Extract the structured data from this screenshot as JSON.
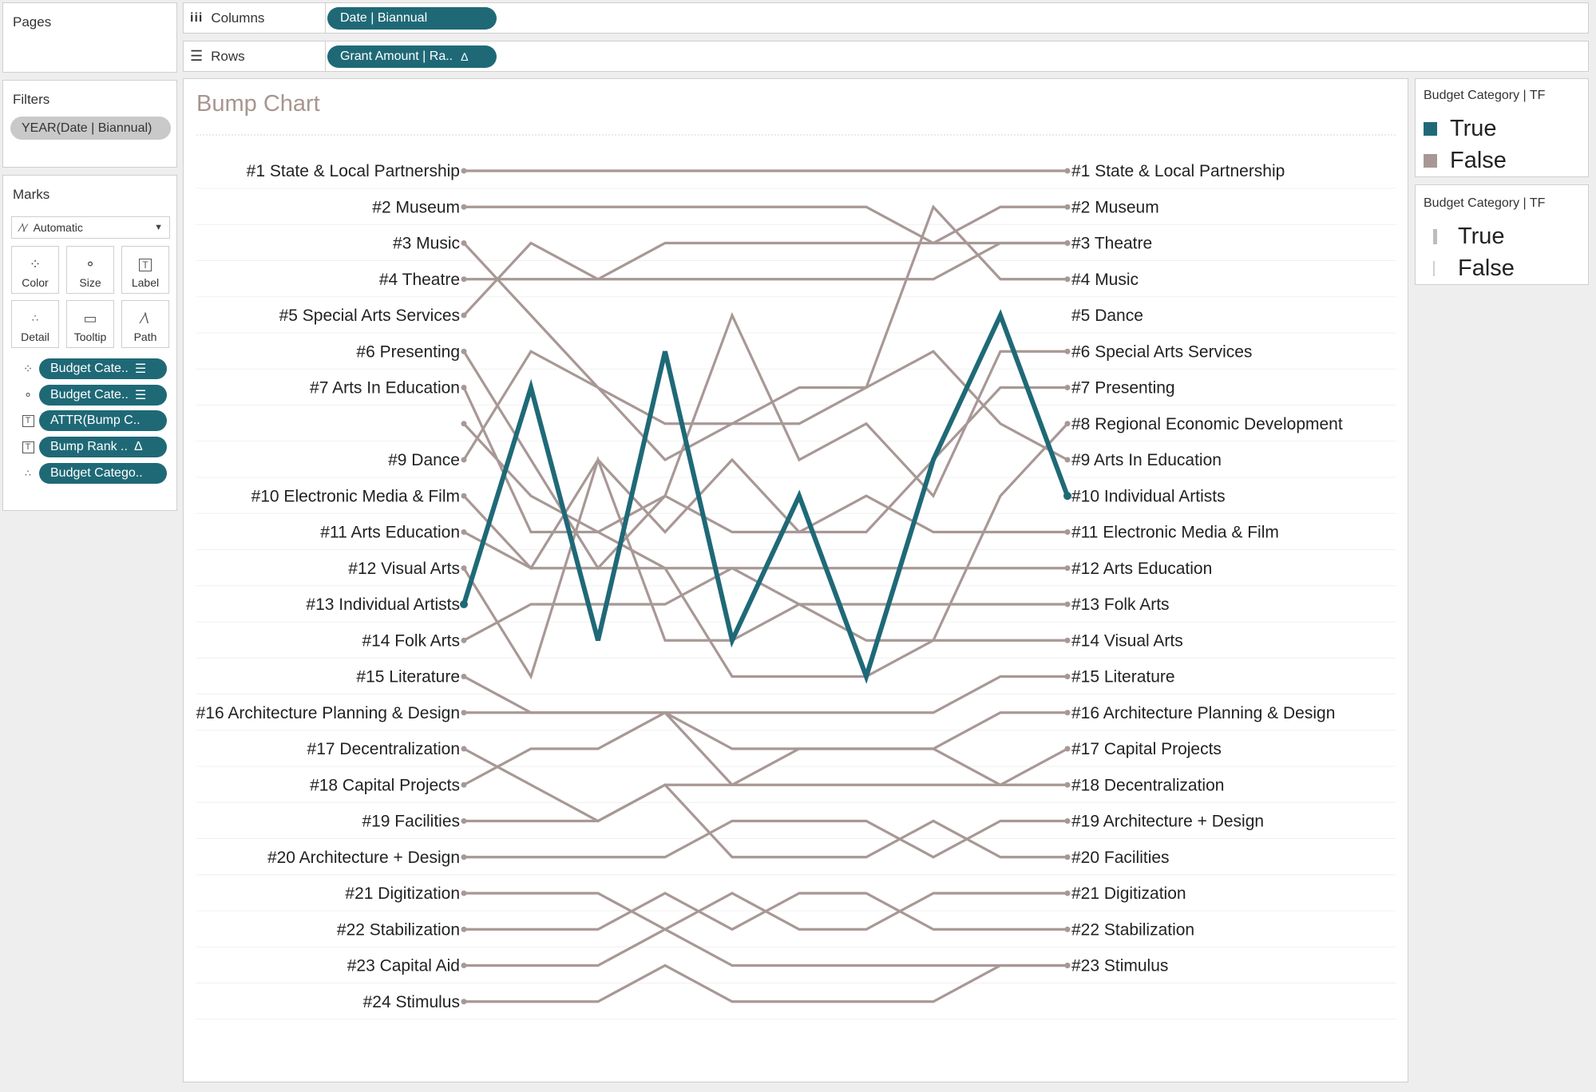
{
  "pages_shelf": {
    "title": "Pages"
  },
  "columns_shelf": {
    "label": "Columns",
    "pill": "Date | Biannual"
  },
  "rows_shelf": {
    "label": "Rows",
    "pill": "Grant Amount | Ra..",
    "pill_delta": "Δ"
  },
  "filters": {
    "title": "Filters",
    "items": [
      "YEAR(Date | Biannual)"
    ]
  },
  "marks": {
    "title": "Marks",
    "type": "Automatic",
    "buttons": {
      "color": "Color",
      "size": "Size",
      "label": "Label",
      "detail": "Detail",
      "tooltip": "Tooltip",
      "path": "Path"
    },
    "fields": [
      {
        "icon": "color-dots-icon",
        "label": "Budget Cate..",
        "suffix": "sort-icon"
      },
      {
        "icon": "size-icon",
        "label": "Budget Cate..",
        "suffix": "sort-icon"
      },
      {
        "icon": "label-text-icon",
        "label": "ATTR(Bump C.."
      },
      {
        "icon": "label-text-icon",
        "label": "Bump Rank ..",
        "suffix": "Δ"
      },
      {
        "icon": "detail-icon",
        "label": "Budget Catego.."
      }
    ]
  },
  "legend_color": {
    "title": "Budget Category | TF",
    "items": [
      {
        "label": "True",
        "color": "#1f6977"
      },
      {
        "label": "False",
        "color": "#a89895"
      }
    ]
  },
  "legend_size": {
    "title": "Budget Category | TF",
    "items": [
      {
        "label": "True"
      },
      {
        "label": "False"
      }
    ]
  },
  "chart_data": {
    "type": "line",
    "title": "Bump Chart",
    "x": [
      0,
      1,
      2,
      3,
      4,
      5,
      6,
      7,
      8,
      9
    ],
    "y_reversed": true,
    "ylim": [
      1,
      24
    ],
    "colors": {
      "highlight": "#1f6977",
      "default": "#a89895"
    },
    "left_labels": [
      {
        "rank": 1,
        "text": "#1 State & Local Partnership"
      },
      {
        "rank": 2,
        "text": "#2 Museum"
      },
      {
        "rank": 3,
        "text": "#3 Music"
      },
      {
        "rank": 4,
        "text": "#4 Theatre"
      },
      {
        "rank": 5,
        "text": "#5 Special Arts Services"
      },
      {
        "rank": 6,
        "text": "#6 Presenting"
      },
      {
        "rank": 7,
        "text": "#7 Arts In Education"
      },
      {
        "rank": 9,
        "text": "#9 Dance"
      },
      {
        "rank": 10,
        "text": "#10 Electronic Media & Film"
      },
      {
        "rank": 11,
        "text": "#11 Arts Education"
      },
      {
        "rank": 12,
        "text": "#12 Visual Arts"
      },
      {
        "rank": 13,
        "text": "#13 Individual Artists"
      },
      {
        "rank": 14,
        "text": "#14 Folk Arts"
      },
      {
        "rank": 15,
        "text": "#15 Literature"
      },
      {
        "rank": 16,
        "text": "#16 Architecture Planning & Design"
      },
      {
        "rank": 17,
        "text": "#17 Decentralization"
      },
      {
        "rank": 18,
        "text": "#18 Capital Projects"
      },
      {
        "rank": 19,
        "text": "#19 Facilities"
      },
      {
        "rank": 20,
        "text": "#20 Architecture + Design"
      },
      {
        "rank": 21,
        "text": "#21 Digitization"
      },
      {
        "rank": 22,
        "text": "#22 Stabilization"
      },
      {
        "rank": 23,
        "text": "#23 Capital Aid"
      },
      {
        "rank": 24,
        "text": "#24 Stimulus"
      }
    ],
    "right_labels": [
      {
        "rank": 1,
        "text": "#1 State & Local Partnership"
      },
      {
        "rank": 2,
        "text": "#2 Museum"
      },
      {
        "rank": 3,
        "text": "#3 Theatre"
      },
      {
        "rank": 4,
        "text": "#4 Music"
      },
      {
        "rank": 5,
        "text": "#5 Dance"
      },
      {
        "rank": 6,
        "text": "#6 Special Arts Services"
      },
      {
        "rank": 7,
        "text": "#7 Presenting"
      },
      {
        "rank": 8,
        "text": "#8 Regional Economic Development"
      },
      {
        "rank": 9,
        "text": "#9 Arts In Education"
      },
      {
        "rank": 10,
        "text": "#10 Individual Artists"
      },
      {
        "rank": 11,
        "text": "#11 Electronic Media & Film"
      },
      {
        "rank": 12,
        "text": "#12 Arts Education"
      },
      {
        "rank": 13,
        "text": "#13 Folk Arts"
      },
      {
        "rank": 14,
        "text": "#14 Visual Arts"
      },
      {
        "rank": 15,
        "text": "#15 Literature"
      },
      {
        "rank": 16,
        "text": "#16 Architecture Planning & Design"
      },
      {
        "rank": 17,
        "text": "#17 Capital Projects"
      },
      {
        "rank": 18,
        "text": "#18 Decentralization"
      },
      {
        "rank": 19,
        "text": "#19 Architecture + Design"
      },
      {
        "rank": 20,
        "text": "#20 Facilities"
      },
      {
        "rank": 21,
        "text": "#21 Digitization"
      },
      {
        "rank": 22,
        "text": "#22 Stabilization"
      },
      {
        "rank": 23,
        "text": "#23 Stimulus"
      }
    ],
    "series": [
      {
        "name": "Individual Artists",
        "highlight": true,
        "values": [
          13,
          7,
          14,
          6,
          14,
          10,
          15,
          9,
          5,
          10
        ]
      },
      {
        "values": [
          1,
          1,
          1,
          1,
          1,
          1,
          1,
          1,
          1,
          1
        ]
      },
      {
        "values": [
          2,
          2,
          2,
          2,
          2,
          2,
          2,
          3,
          2,
          2
        ]
      },
      {
        "values": [
          3,
          5,
          7,
          9,
          8,
          7,
          7,
          2,
          4,
          4
        ]
      },
      {
        "values": [
          4,
          4,
          4,
          4,
          4,
          4,
          4,
          4,
          3,
          3
        ]
      },
      {
        "values": [
          5,
          3,
          4,
          3,
          3,
          3,
          3,
          3,
          3,
          3
        ]
      },
      {
        "values": [
          6,
          9,
          12,
          10,
          11,
          11,
          11,
          9,
          7,
          7
        ]
      },
      {
        "values": [
          7,
          11,
          11,
          10,
          5,
          9,
          8,
          10,
          6,
          6
        ]
      },
      {
        "values": [
          9,
          6,
          7,
          8,
          8,
          8,
          7,
          6,
          8,
          9
        ]
      },
      {
        "values": [
          10,
          12,
          9,
          11,
          9,
          11,
          10,
          11,
          11,
          11
        ]
      },
      {
        "values": [
          11,
          12,
          12,
          12,
          12,
          12,
          12,
          12,
          12,
          12
        ]
      },
      {
        "values": [
          12,
          15,
          9,
          14,
          14,
          13,
          14,
          14,
          14,
          14
        ]
      },
      {
        "values": [
          14,
          13,
          13,
          13,
          12,
          13,
          13,
          13,
          13,
          13
        ]
      },
      {
        "values": [
          15,
          16,
          16,
          16,
          16,
          16,
          16,
          16,
          15,
          15
        ]
      },
      {
        "values": [
          16,
          16,
          16,
          16,
          17,
          17,
          17,
          17,
          16,
          16
        ]
      },
      {
        "values": [
          17,
          18,
          19,
          18,
          18,
          18,
          18,
          18,
          18,
          18
        ]
      },
      {
        "values": [
          18,
          17,
          17,
          16,
          18,
          17,
          17,
          17,
          18,
          17
        ]
      },
      {
        "values": [
          19,
          19,
          19,
          18,
          20,
          20,
          20,
          19,
          20,
          20
        ]
      },
      {
        "values": [
          20,
          20,
          20,
          20,
          19,
          19,
          19,
          20,
          19,
          19
        ]
      },
      {
        "values": [
          21,
          21,
          21,
          22,
          21,
          22,
          22,
          21,
          21,
          21
        ]
      },
      {
        "values": [
          22,
          22,
          22,
          21,
          22,
          21,
          21,
          22,
          22,
          22
        ]
      },
      {
        "values": [
          23,
          23,
          23,
          22,
          23,
          23,
          23,
          23,
          23,
          23
        ]
      },
      {
        "values": [
          24,
          24,
          24,
          23,
          24,
          24,
          24,
          24,
          23,
          23
        ]
      },
      {
        "values": [
          8,
          10,
          11,
          12,
          15,
          15,
          15,
          14,
          10,
          8
        ]
      }
    ]
  }
}
